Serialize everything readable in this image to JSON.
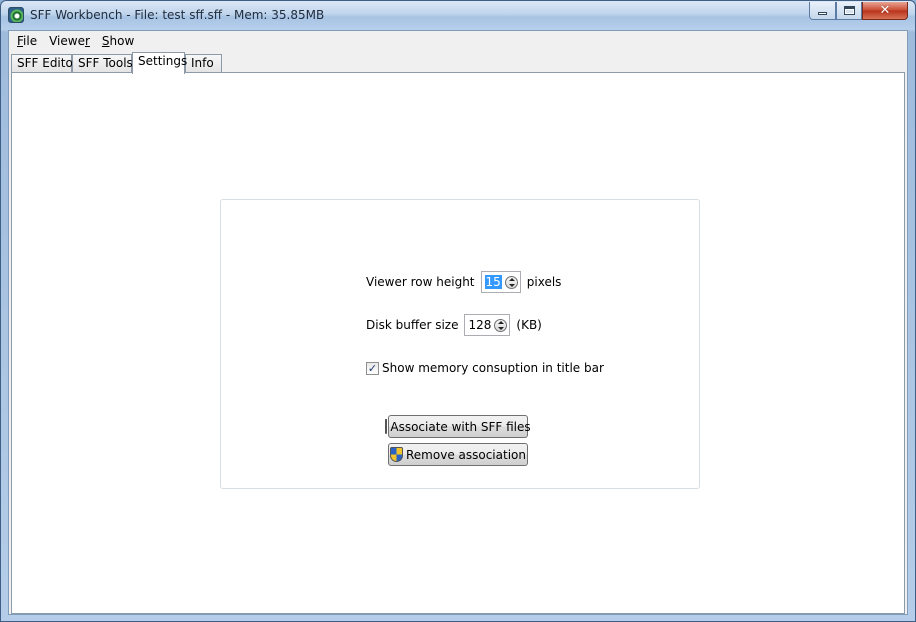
{
  "window": {
    "title": "SFF Workbench - File: test sff.sff -  Mem: 35.85MB",
    "controls": {
      "minimize": "",
      "maximize": "",
      "close": "✕"
    }
  },
  "menu": {
    "file": {
      "accel": "F",
      "rest": "ile"
    },
    "viewer": {
      "pre": "Viewe",
      "accel": "r",
      "rest": ""
    },
    "show": {
      "accel": "S",
      "rest": "how"
    }
  },
  "tabs": [
    {
      "label": "SFF Editor"
    },
    {
      "label": "SFF Tools"
    },
    {
      "label": "Settings"
    },
    {
      "label": "Info"
    }
  ],
  "active_tab": "Settings",
  "settings": {
    "row_height_label": "Viewer row height",
    "row_height_value": "15",
    "row_height_unit": "pixels",
    "buffer_label": "Disk buffer size",
    "buffer_value": "128",
    "buffer_unit": "(KB)",
    "memory_checkbox_label": "Show memory consuption in title bar",
    "memory_checkbox_checked": true,
    "check_mark": "✓",
    "associate_button": "Associate with SFF files",
    "remove_button": "Remove association"
  }
}
